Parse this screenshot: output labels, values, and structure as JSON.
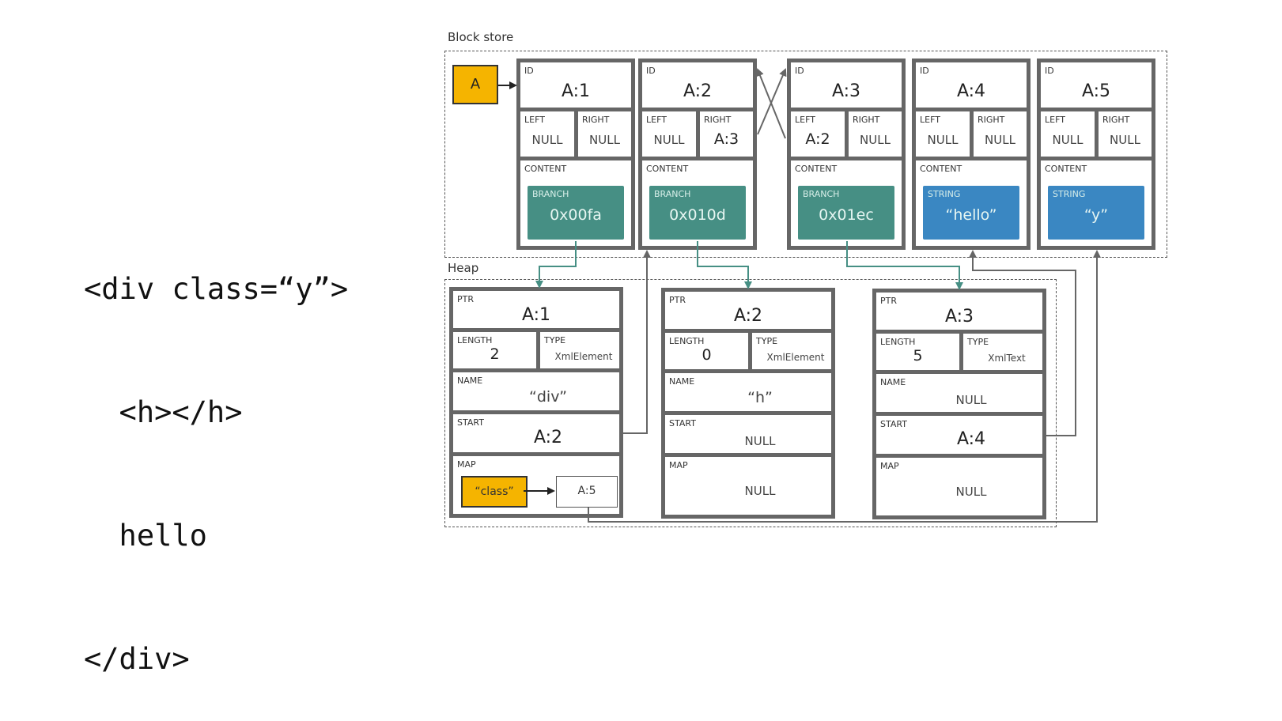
{
  "code_sample": {
    "lines": [
      "<div class=“y”>",
      "  <h></h>",
      "  hello",
      "</div>"
    ]
  },
  "block_store": {
    "title": "Block store",
    "root_label": "A",
    "field_labels": {
      "id": "ID",
      "left": "LEFT",
      "right": "RIGHT",
      "content": "CONTENT"
    },
    "blocks": [
      {
        "id": "A:1",
        "left": "NULL",
        "right": "NULL",
        "content_type": "BRANCH",
        "content_value": "0x00fa"
      },
      {
        "id": "A:2",
        "left": "NULL",
        "right": "A:3",
        "content_type": "BRANCH",
        "content_value": "0x010d"
      },
      {
        "id": "A:3",
        "left": "A:2",
        "right": "NULL",
        "content_type": "BRANCH",
        "content_value": "0x01ec"
      },
      {
        "id": "A:4",
        "left": "NULL",
        "right": "NULL",
        "content_type": "STRING",
        "content_value": "“hello”"
      },
      {
        "id": "A:5",
        "left": "NULL",
        "right": "NULL",
        "content_type": "STRING",
        "content_value": "“y”"
      }
    ]
  },
  "heap": {
    "title": "Heap",
    "field_labels": {
      "ptr": "PTR",
      "length": "LENGTH",
      "type": "TYPE",
      "name": "NAME",
      "start": "START",
      "map": "MAP"
    },
    "entries": [
      {
        "ptr": "A:1",
        "length": "2",
        "type": "XmlElement",
        "name": "“div”",
        "start": "A:2",
        "map_key": "“class”",
        "map_value": "A:5"
      },
      {
        "ptr": "A:2",
        "length": "0",
        "type": "XmlElement",
        "name": "“h”",
        "start": "NULL",
        "map": "NULL"
      },
      {
        "ptr": "A:3",
        "length": "5",
        "type": "XmlText",
        "name": "NULL",
        "start": "A:4",
        "map": "NULL"
      }
    ]
  },
  "colors": {
    "branch": "#468f84",
    "string": "#3a87c2",
    "root_key": "#f5b400",
    "block_border": "#666666",
    "branch_link": "#468f84",
    "pointer_link": "#666666"
  }
}
